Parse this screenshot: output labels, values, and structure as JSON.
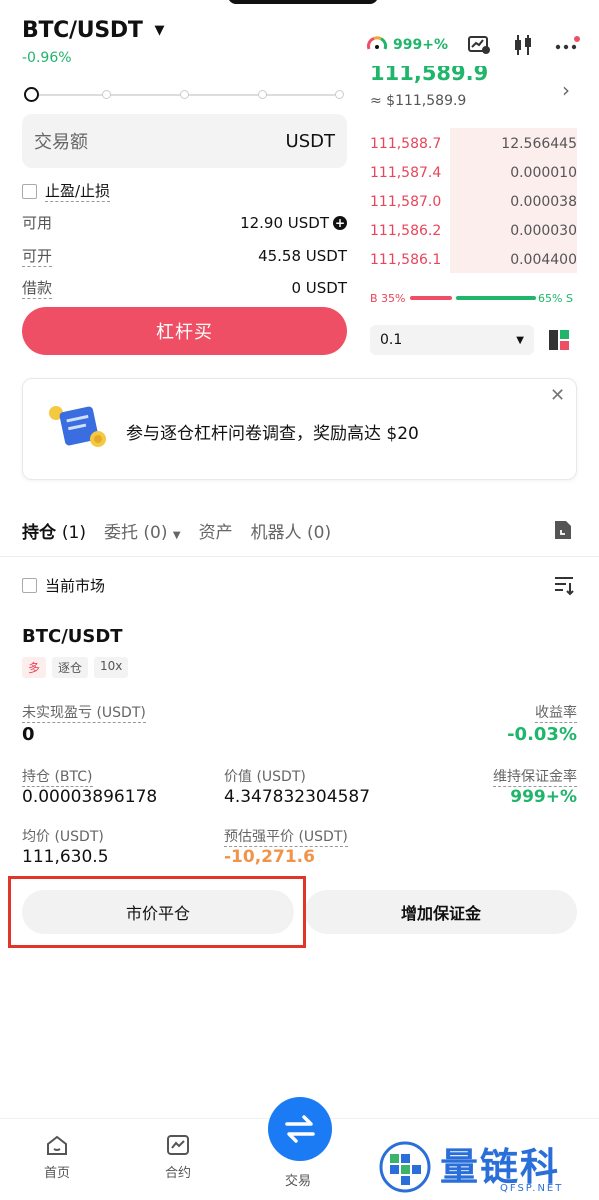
{
  "header": {
    "pair": "BTC/USDT",
    "change": "-0.96%",
    "margin_ratio": "999+%"
  },
  "order_form": {
    "amount_placeholder": "交易额",
    "amount_unit": "USDT",
    "tpsl_label": "止盈/止损",
    "available_label": "可用",
    "available_value": "12.90 USDT",
    "openable_label": "可开",
    "openable_value": "45.58 USDT",
    "borrow_label": "借款",
    "borrow_value": "0 USDT",
    "buy_button": "杠杆买"
  },
  "order_book": {
    "last_price": "111,589.9",
    "index_price": "≈ $111,589.9",
    "asks": [
      {
        "price": "111,588.7",
        "qty": "12.566445"
      },
      {
        "price": "111,587.4",
        "qty": "0.000010"
      },
      {
        "price": "111,587.0",
        "qty": "0.000038"
      },
      {
        "price": "111,586.2",
        "qty": "0.000030"
      },
      {
        "price": "111,586.1",
        "qty": "0.004400"
      }
    ],
    "buy_ratio": "B 35%",
    "sell_ratio": "65% S",
    "buy_ratio_fraction": 0.35,
    "precision": "0.1"
  },
  "banner": {
    "text": "参与逐仓杠杆问卷调查，奖励高达 $20"
  },
  "tabs": {
    "positions": "持仓",
    "positions_count": "(1)",
    "orders": "委托 (0)",
    "assets": "资产",
    "bots": "机器人 (0)"
  },
  "filter": {
    "current_market": "当前市场"
  },
  "position": {
    "pair": "BTC/USDT",
    "tag_side": "多",
    "tag_mode": "逐仓",
    "tag_leverage": "10x",
    "unrealized_label": "未实现盈亏 (USDT)",
    "unrealized_value": "0",
    "roi_label": "收益率",
    "roi_value": "-0.03%",
    "size_label": "持仓 (BTC)",
    "size_value": "0.00003896178",
    "value_label": "价值 (USDT)",
    "value_value": "4.347832304587",
    "mmr_label": "维持保证金率",
    "mmr_value": "999+%",
    "avg_label": "均价 (USDT)",
    "avg_value": "111,630.5",
    "liq_label": "预估强平价 (USDT)",
    "liq_value": "-10,271.6",
    "close_button": "市价平仓",
    "add_margin_button": "增加保证金"
  },
  "nav": {
    "home": "首页",
    "futures": "合约",
    "trade": "交易"
  },
  "watermark": {
    "text": "量链科技",
    "domain": "QFSP.NET"
  }
}
